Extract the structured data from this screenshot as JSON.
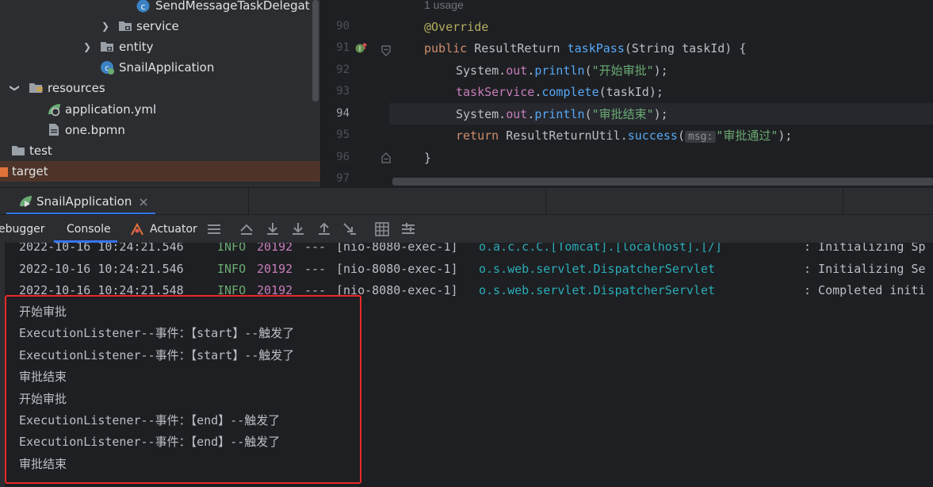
{
  "project_tree": {
    "items": [
      {
        "label": "SendMessageTaskDelegat",
        "icon": "class-icon"
      },
      {
        "label": "service",
        "icon": "folder-icon"
      },
      {
        "label": "entity",
        "icon": "folder-icon"
      },
      {
        "label": "SnailApplication",
        "icon": "spring-class-icon"
      },
      {
        "label": "resources",
        "icon": "resources-folder-icon"
      },
      {
        "label": "application.yml",
        "icon": "spring-yaml-icon"
      },
      {
        "label": "one.bpmn",
        "icon": "file-icon"
      },
      {
        "label": "test",
        "icon": "folder-icon"
      },
      {
        "label": "target",
        "icon": "excluded-folder-icon"
      }
    ]
  },
  "editor": {
    "usage_hint": "1 usage",
    "line_numbers": [
      "90",
      "91",
      "92",
      "93",
      "94",
      "95",
      "96",
      "97"
    ],
    "current_line": "94",
    "code": {
      "l90": "@Override",
      "l91_kw": "public",
      "l91_type": "ResultReturn",
      "l91_fn": "taskPass",
      "l91_params": "(String taskId) {",
      "l92_a": "System.",
      "l92_out": "out",
      "l92_b": ".",
      "l92_fn": "println",
      "l92_c": "(",
      "l92_str": "\"开始审批\"",
      "l92_d": ");",
      "l93_field": "taskService",
      "l93_b": ".",
      "l93_fn": "complete",
      "l93_c": "(taskId);",
      "l94_a": "System.",
      "l94_out": "out",
      "l94_b": ".",
      "l94_fn": "println",
      "l94_c": "(",
      "l94_str": "\"审批结束\"",
      "l94_d": ");",
      "l95_kw": "return",
      "l95_a": "ResultReturnUtil.",
      "l95_fn": "success",
      "l95_b": "(",
      "l95_hint": "msg:",
      "l95_str": "\"审批通过\"",
      "l95_c": ");",
      "l96": "}"
    }
  },
  "run_tabs": {
    "active_tab": "SnailApplication",
    "close_glyph": "×"
  },
  "console_toolbar": {
    "debugger_label": "ebugger",
    "console_label": "Console",
    "actuator_label": "Actuator"
  },
  "console": {
    "log_lines": [
      {
        "ts": "2022-10-16 10:24:21.546",
        "level": "INFO",
        "pid": "20192",
        "sep": "---",
        "thread": "[nio-8080-exec-1]",
        "logger": "o.a.c.c.C.[Tomcat].[localhost].[/]",
        "msg": ": Initializing Sp"
      },
      {
        "ts": "2022-10-16 10:24:21.546",
        "level": "INFO",
        "pid": "20192",
        "sep": "---",
        "thread": "[nio-8080-exec-1]",
        "logger": "o.s.web.servlet.DispatcherServlet",
        "msg": ": Initializing Se"
      },
      {
        "ts": "2022-10-16 10:24:21.548",
        "level": "INFO",
        "pid": "20192",
        "sep": "---",
        "thread": "[nio-8080-exec-1]",
        "logger": "o.s.web.servlet.DispatcherServlet",
        "msg": ": Completed initi"
      }
    ],
    "output_lines": [
      "开始审批",
      "ExecutionListener--事件：【start】--触发了",
      "ExecutionListener--事件：【start】--触发了",
      "审批结束",
      "开始审批",
      "ExecutionListener--事件：【end】--触发了",
      "ExecutionListener--事件：【end】--触发了",
      "审批结束"
    ]
  },
  "colors": {
    "highlight_box": "#e8292b",
    "selected_tab_underline": "#3574f0"
  }
}
